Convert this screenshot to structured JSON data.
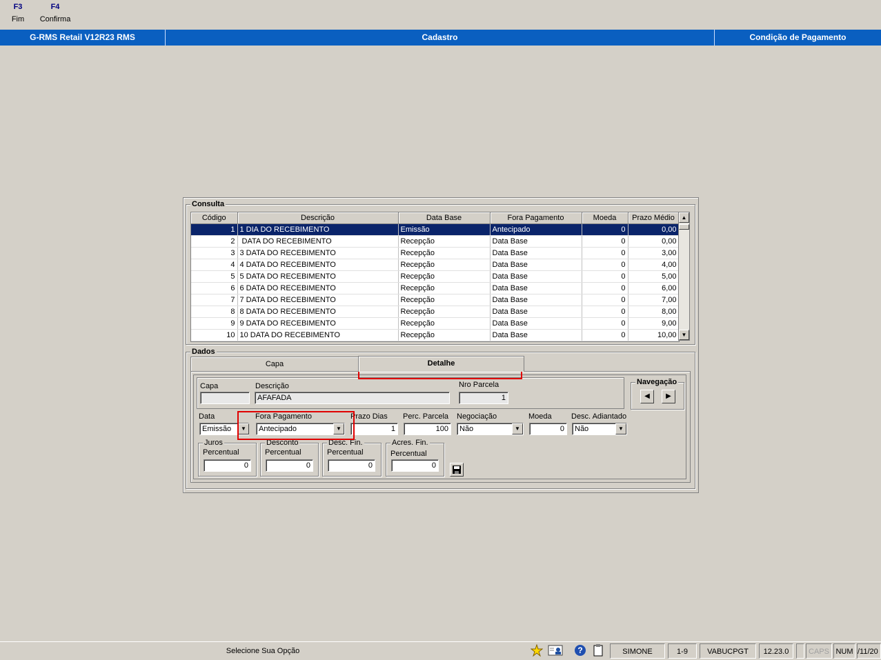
{
  "fkeys": [
    {
      "key": "F3",
      "label": "Fim"
    },
    {
      "key": "F4",
      "label": "Confirma"
    }
  ],
  "titlebar": {
    "app": "G-RMS Retail V12R23 RMS",
    "module": "Cadastro",
    "screen": "Condição de Pagamento"
  },
  "consulta": {
    "title": "Consulta",
    "columns": [
      "Código",
      "Descrição",
      "Data Base",
      "Fora Pagamento",
      "Moeda",
      "Prazo Médio"
    ],
    "rows": [
      {
        "codigo": "1",
        "descricao": "1 DIA DO RECEBIMENTO",
        "data_base": "Emissão",
        "fora_pagamento": "Antecipado",
        "moeda": "0",
        "prazo": "0,00"
      },
      {
        "codigo": "2",
        "descricao": " DATA DO RECEBIMENTO",
        "data_base": "Recepção",
        "fora_pagamento": "Data Base",
        "moeda": "0",
        "prazo": "0,00"
      },
      {
        "codigo": "3",
        "descricao": "3 DATA DO RECEBIMENTO",
        "data_base": "Recepção",
        "fora_pagamento": "Data Base",
        "moeda": "0",
        "prazo": "3,00"
      },
      {
        "codigo": "4",
        "descricao": "4 DATA DO RECEBIMENTO",
        "data_base": "Recepção",
        "fora_pagamento": "Data Base",
        "moeda": "0",
        "prazo": "4,00"
      },
      {
        "codigo": "5",
        "descricao": "5 DATA DO RECEBIMENTO",
        "data_base": "Recepção",
        "fora_pagamento": "Data Base",
        "moeda": "0",
        "prazo": "5,00"
      },
      {
        "codigo": "6",
        "descricao": "6 DATA DO RECEBIMENTO",
        "data_base": "Recepção",
        "fora_pagamento": "Data Base",
        "moeda": "0",
        "prazo": "6,00"
      },
      {
        "codigo": "7",
        "descricao": "7 DATA DO RECEBIMENTO",
        "data_base": "Recepção",
        "fora_pagamento": "Data Base",
        "moeda": "0",
        "prazo": "7,00"
      },
      {
        "codigo": "8",
        "descricao": "8 DATA DO RECEBIMENTO",
        "data_base": "Recepção",
        "fora_pagamento": "Data Base",
        "moeda": "0",
        "prazo": "8,00"
      },
      {
        "codigo": "9",
        "descricao": "9 DATA DO RECEBIMENTO",
        "data_base": "Recepção",
        "fora_pagamento": "Data Base",
        "moeda": "0",
        "prazo": "9,00"
      },
      {
        "codigo": "10",
        "descricao": "10 DATA DO RECEBIMENTO",
        "data_base": "Recepção",
        "fora_pagamento": "Data Base",
        "moeda": "0",
        "prazo": "10,00"
      }
    ]
  },
  "dados": {
    "title": "Dados",
    "tabs": [
      "Capa",
      "Detalhe"
    ],
    "capa_label": "Capa",
    "capa_value": "",
    "descricao_label": "Descrição",
    "descricao_value": "AFAFADA",
    "nro_parcela_label": "Nro Parcela",
    "nro_parcela_value": "1",
    "navegacao_label": "Navegação",
    "data_label": "Data",
    "data_value": "Emissão",
    "fora_label": "Fora Pagamento",
    "fora_value": "Antecipado",
    "prazo_label": "Prazo Dias",
    "prazo_value": "1",
    "perc_label": "Perc. Parcela",
    "perc_value": "100",
    "negociacao_label": "Negociação",
    "negociacao_value": "Não",
    "moeda_label": "Moeda",
    "moeda_value": "0",
    "desc_adiant_label": "Desc. Adiantado",
    "desc_adiant_value": "Não",
    "juros_title": "Juros",
    "desconto_title": "Desconto",
    "descfin_title": "Desc. Fin.",
    "acresfin_title": "Acres. Fin.",
    "percentual_label": "Percentual",
    "juros_value": "0",
    "desconto_value": "0",
    "descfin_value": "0",
    "acresfin_value": "0"
  },
  "status": {
    "message": "Selecione Sua Opção",
    "user": "SIMONE",
    "page": "1-9",
    "program": "VABUCPGT",
    "version": "12.23.0",
    "caps": "CAPS",
    "num": "NUM",
    "date": "/11/20"
  },
  "colors": {
    "titlebar": "#0a5fc0",
    "selected_row": "#0a246a",
    "highlight": "#e00000"
  }
}
